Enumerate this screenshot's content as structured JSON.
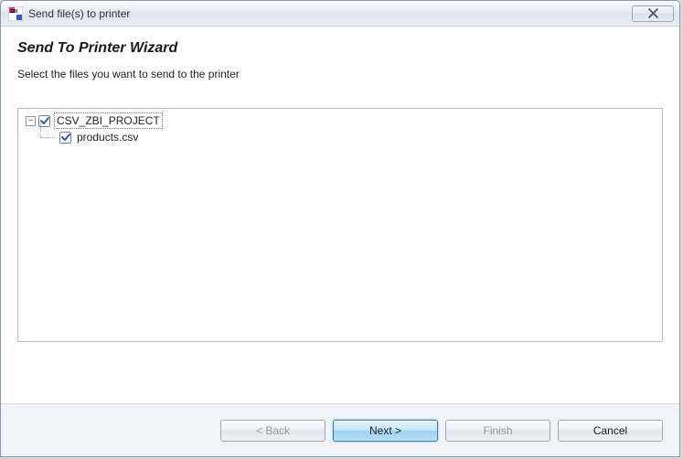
{
  "window": {
    "title": "Send file(s) to printer"
  },
  "header": {
    "wizardTitle": "Send To Printer Wizard",
    "subtitle": "Select the files you want to send to the printer"
  },
  "tree": {
    "root": {
      "expanded": true,
      "toggleGlyph": "−",
      "checked": true,
      "label": "CSV_ZBI_PROJECT",
      "children": [
        {
          "checked": true,
          "label": "products.csv"
        }
      ]
    }
  },
  "buttons": {
    "back": "< Back",
    "next": "Next >",
    "finish": "Finish",
    "cancel": "Cancel"
  }
}
